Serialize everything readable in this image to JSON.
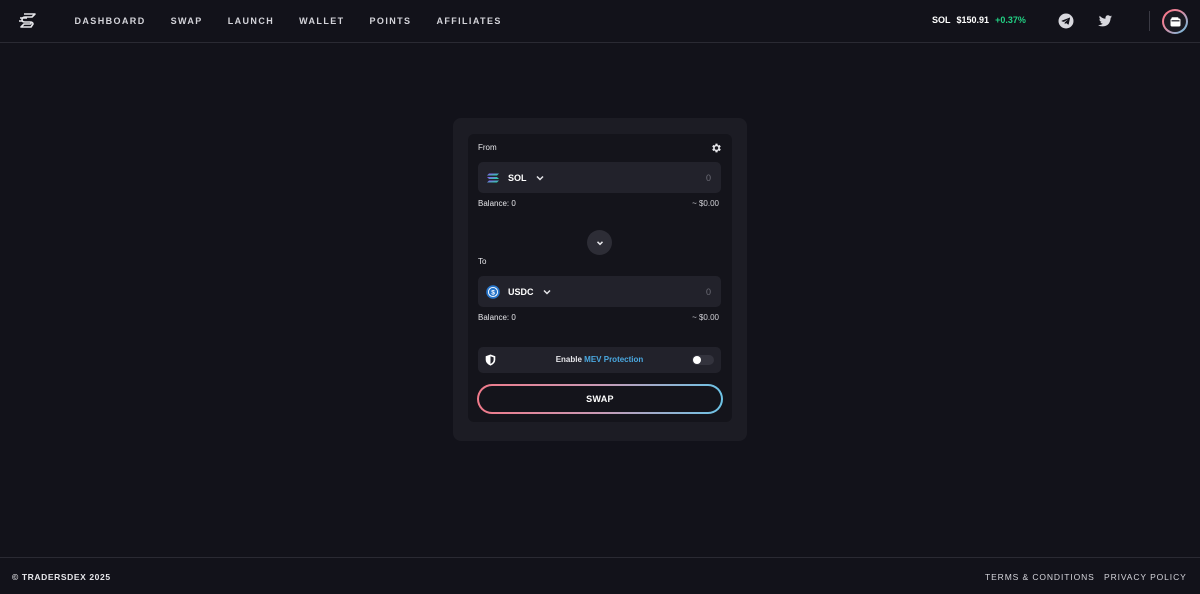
{
  "nav": {
    "logo_icon": "tradersdex-logo-icon",
    "items": [
      {
        "label": "DASHBOARD"
      },
      {
        "label": "SWAP"
      },
      {
        "label": "LAUNCH"
      },
      {
        "label": "WALLET"
      },
      {
        "label": "POINTS"
      },
      {
        "label": "AFFILIATES"
      }
    ]
  },
  "ticker": {
    "symbol": "SOL",
    "price": "$150.91",
    "change": "+0.37%",
    "change_color": "#22d184"
  },
  "header_icons": [
    "telegram-icon",
    "twitter-icon",
    "wallet-icon"
  ],
  "swap": {
    "from": {
      "label": "From",
      "token": "SOL",
      "amount_placeholder": "0",
      "balance": "Balance: 0",
      "usd_value": "~ $0.00"
    },
    "to": {
      "label": "To",
      "token": "USDC",
      "amount_placeholder": "0",
      "balance": "Balance: 0",
      "usd_value": "~ $0.00"
    },
    "mev": {
      "enable_text": "Enable",
      "protection_text": "MEV Protection",
      "enabled": false
    },
    "button_label": "SWAP"
  },
  "footer": {
    "copyright": "© TRADERSDEX 2025",
    "terms": "TERMS & CONDITIONS",
    "privacy": "PRIVACY POLICY"
  },
  "colors": {
    "background": "#12121a",
    "card": "#1c1c24",
    "accent_blue": "#4aa8e0",
    "gradient_start": "#f07a8a",
    "gradient_end": "#6cc3e6"
  }
}
